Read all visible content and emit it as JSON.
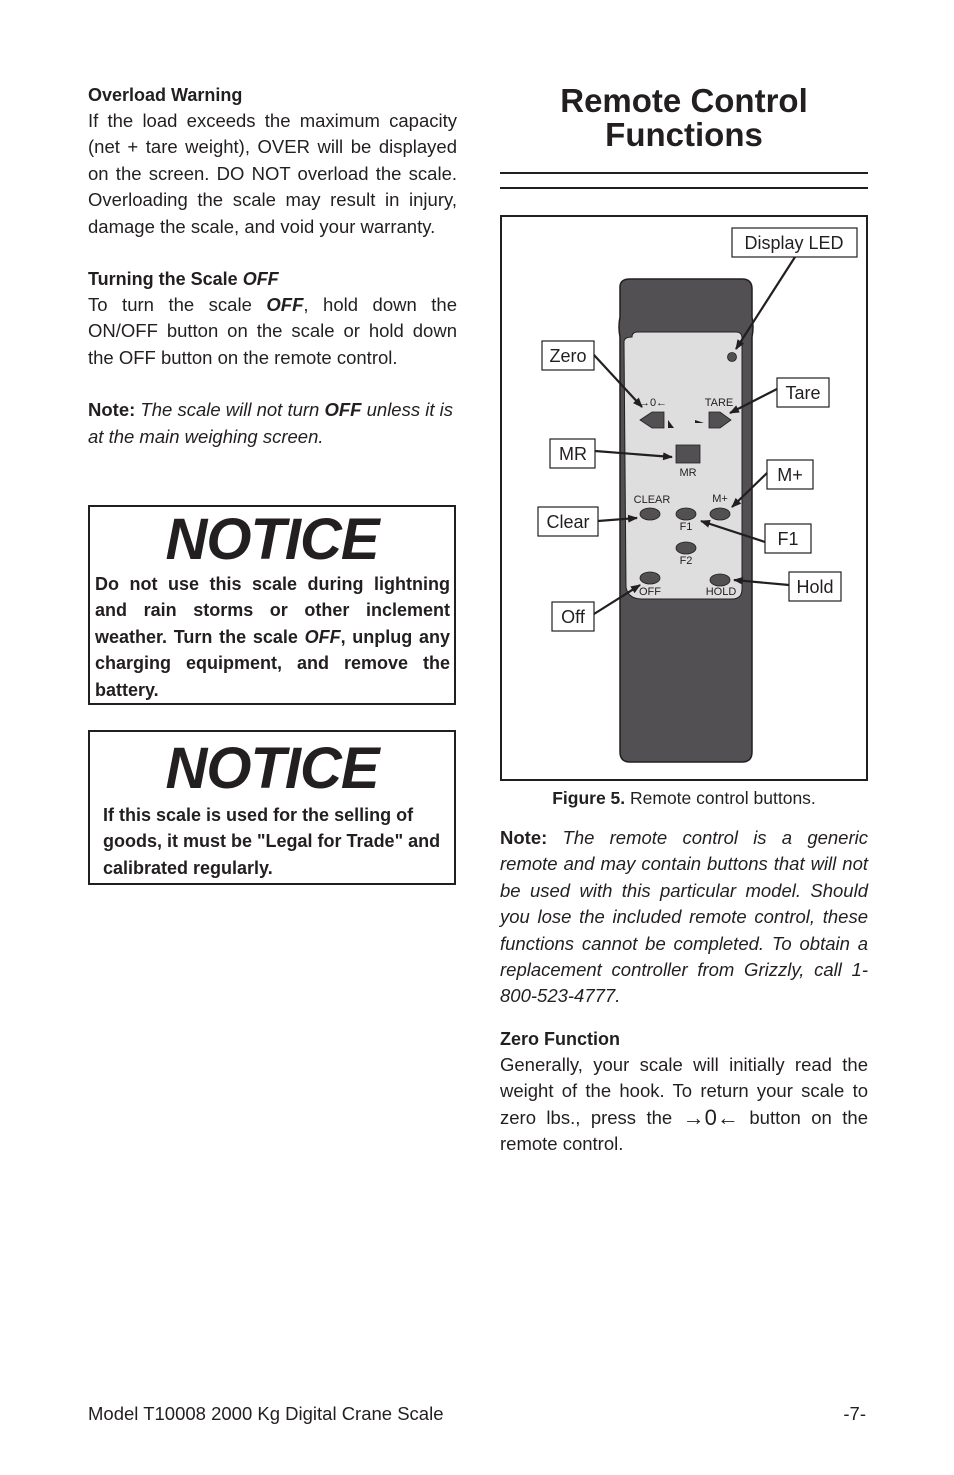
{
  "left_column": {
    "overload": {
      "heading": "Overload Warning",
      "body": "If the load exceeds the maximum capacity (net + tare weight), OVER will be displayed on the screen. DO NOT overload the scale. Overloading the scale may result in injury, damage the scale, and void your warranty."
    },
    "turning_off": {
      "heading_prefix": "Turning the Scale ",
      "heading_emph": "OFF",
      "body_prefix": "To turn the scale ",
      "body_emph": "OFF",
      "body_suffix": ", hold down the ON/OFF button on the scale or hold down the OFF button on the remote control."
    },
    "note": {
      "label": "Note:",
      "text_prefix": " The scale will not turn ",
      "text_emph": "OFF",
      "text_suffix": " unless it is at the main weighing screen."
    }
  },
  "notices": [
    {
      "title": "NOTICE",
      "body_prefix": "Do not use this scale during lightning and rain storms or other inclement weather. Turn the scale ",
      "body_emph": "OFF",
      "body_suffix": ", unplug any charging equipment, and remove the battery."
    },
    {
      "title": "NOTICE",
      "body": "If this scale is used for the selling of goods, it must be \"Legal for Trade\" and calibrated regularly."
    }
  ],
  "right_column": {
    "section_title_line1": "Remote Control",
    "section_title_line2": "Functions",
    "figure": {
      "callouts": {
        "display_led": "Display LED",
        "zero": "Zero",
        "tare": "Tare",
        "mr": "MR",
        "m_plus": "M+",
        "clear": "Clear",
        "f1": "F1",
        "hold": "Hold",
        "off": "Off"
      },
      "button_labels": {
        "zero": "→0←",
        "tare": "TARE",
        "mr": "MR",
        "clear": "CLEAR",
        "m_plus": "M+",
        "f1": "F1",
        "f2": "F2",
        "off": "OFF",
        "hold": "HOLD"
      },
      "caption_label": "Figure 5.",
      "caption_text": " Remote control buttons."
    },
    "note": {
      "label": "Note:",
      "text": " The remote control is a generic remote and may contain buttons that will not be used with this particular model. Should you lose the included remote control, these functions cannot be completed. To obtain a replacement controller from Grizzly, call 1-800-523-4777."
    },
    "zero_function": {
      "heading": "Zero Function",
      "body_prefix": "Generally, your scale will initially read the weight of the hook. To return your scale to zero lbs., press the ",
      "symbol": "→0←",
      "body_suffix": " button on the remote control."
    }
  },
  "footer": {
    "model": "Model T10008 2000 Kg Digital Crane Scale",
    "page": "-7-"
  }
}
